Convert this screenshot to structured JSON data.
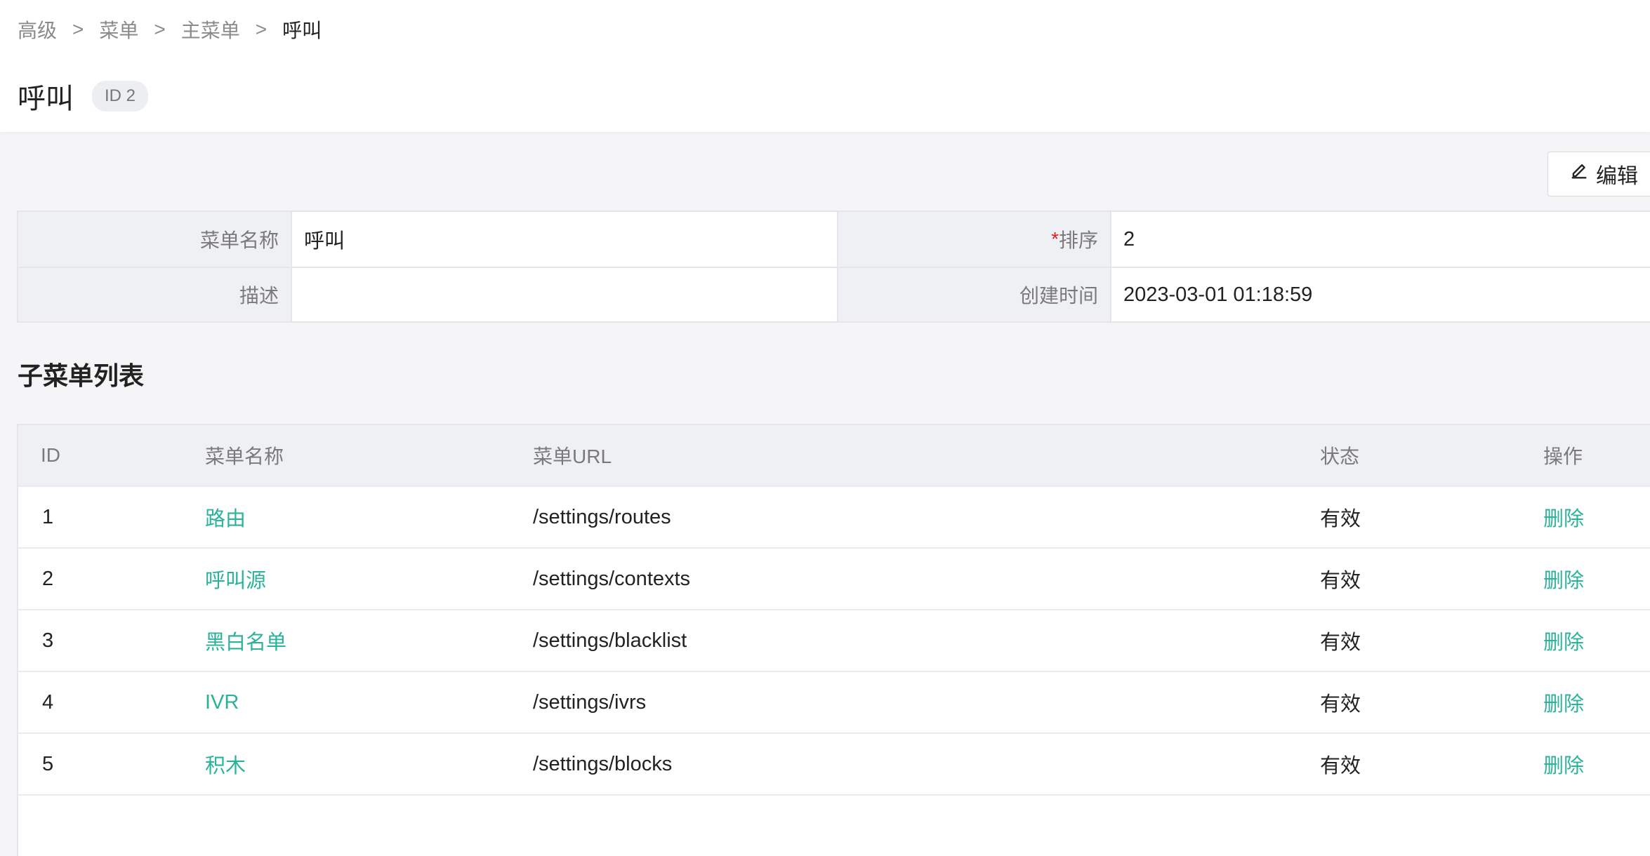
{
  "breadcrumb": {
    "items": [
      "高级",
      "菜单",
      "主菜单"
    ],
    "current": "呼叫",
    "separator": ">"
  },
  "page": {
    "title": "呼叫",
    "id_badge": "ID 2"
  },
  "toolbar": {
    "edit_label": "编辑"
  },
  "info": {
    "name_label": "菜单名称",
    "name_value": "呼叫",
    "order_required": "*",
    "order_label": "排序",
    "order_value": "2",
    "desc_label": "描述",
    "desc_value": "",
    "created_label": "创建时间",
    "created_value": "2023-03-01 01:18:59"
  },
  "submenu": {
    "title": "子菜单列表",
    "columns": [
      "ID",
      "菜单名称",
      "菜单URL",
      "状态",
      "操作"
    ],
    "rows": [
      {
        "id": "1",
        "name": "路由",
        "url": "/settings/routes",
        "status": "有效",
        "action": "删除"
      },
      {
        "id": "2",
        "name": "呼叫源",
        "url": "/settings/contexts",
        "status": "有效",
        "action": "删除"
      },
      {
        "id": "3",
        "name": "黑白名单",
        "url": "/settings/blacklist",
        "status": "有效",
        "action": "删除"
      },
      {
        "id": "4",
        "name": "IVR",
        "url": "/settings/ivrs",
        "status": "有效",
        "action": "删除"
      },
      {
        "id": "5",
        "name": "积木",
        "url": "/settings/blocks",
        "status": "有效",
        "action": "删除"
      }
    ]
  },
  "colors": {
    "accent": "#2bb39a",
    "required": "#e02020",
    "label_bg": "#eff0f4"
  },
  "icons": {
    "edit": "pencil-icon"
  }
}
